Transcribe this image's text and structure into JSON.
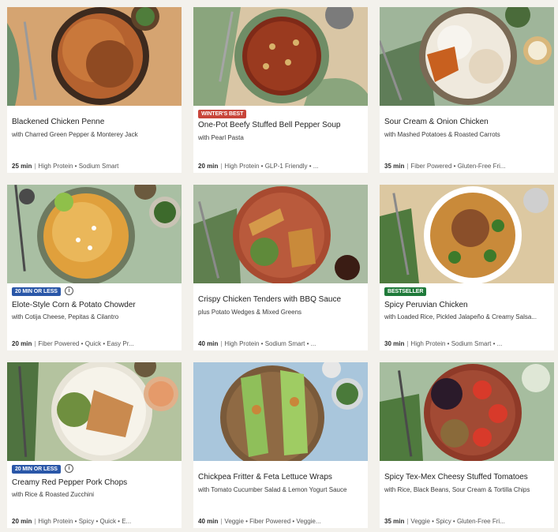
{
  "recipes": [
    {
      "title": "Blackened Chicken Penne",
      "subtitle": "with Charred Green Pepper & Monterey Jack",
      "time": "25 min",
      "tags": "High Protein • Sodium Smart",
      "badge": ""
    },
    {
      "title": "One-Pot Beefy Stuffed Bell Pepper Soup",
      "subtitle": "with Pearl Pasta",
      "time": "20 min",
      "tags": "High Protein • GLP-1 Friendly • ...",
      "badge": "WINTER'S BEST"
    },
    {
      "title": "Sour Cream & Onion Chicken",
      "subtitle": "with Mashed Potatoes & Roasted Carrots",
      "time": "35 min",
      "tags": "Fiber Powered • Gluten-Free Fri...",
      "badge": ""
    },
    {
      "title": "Elote-Style Corn & Potato Chowder",
      "subtitle": "with Cotija Cheese, Pepitas & Cilantro",
      "time": "20 min",
      "tags": "Fiber Powered • Quick • Easy Pr...",
      "badge": "20 MIN OR LESS"
    },
    {
      "title": "Crispy Chicken Tenders with BBQ Sauce",
      "subtitle": "plus Potato Wedges & Mixed Greens",
      "time": "40 min",
      "tags": "High Protein • Sodium Smart • ...",
      "badge": ""
    },
    {
      "title": "Spicy Peruvian Chicken",
      "subtitle": "with Loaded Rice, Pickled Jalapeño & Creamy Salsa...",
      "time": "30 min",
      "tags": "High Protein • Sodium Smart • ...",
      "badge": "BESTSELLER"
    },
    {
      "title": "Creamy Red Pepper Pork Chops",
      "subtitle": "with Rice & Roasted Zucchini",
      "time": "20 min",
      "tags": "High Protein • Spicy • Quick • E...",
      "badge": "20 MIN OR LESS"
    },
    {
      "title": "Chickpea Fritter & Feta Lettuce Wraps",
      "subtitle": "with Tomato Cucumber Salad & Lemon Yogurt Sauce",
      "time": "40 min",
      "tags": "Veggie • Fiber Powered • Veggie...",
      "badge": ""
    },
    {
      "title": "Spicy Tex-Mex Cheesy Stuffed Tomatoes",
      "subtitle": "with Rice, Black Beans, Sour Cream & Tortilla Chips",
      "time": "35 min",
      "tags": "Veggie • Spicy • Gluten-Free Fri...",
      "badge": ""
    }
  ],
  "icons": {
    "info": "info-icon"
  },
  "info_glyph": "i",
  "colors": {
    "winter_badge": "#c8453a",
    "speed_badge": "#2a57a8",
    "best_badge": "#1f7a3a",
    "card_bg": "#ffffff",
    "page_bg": "#f3f1ec"
  }
}
